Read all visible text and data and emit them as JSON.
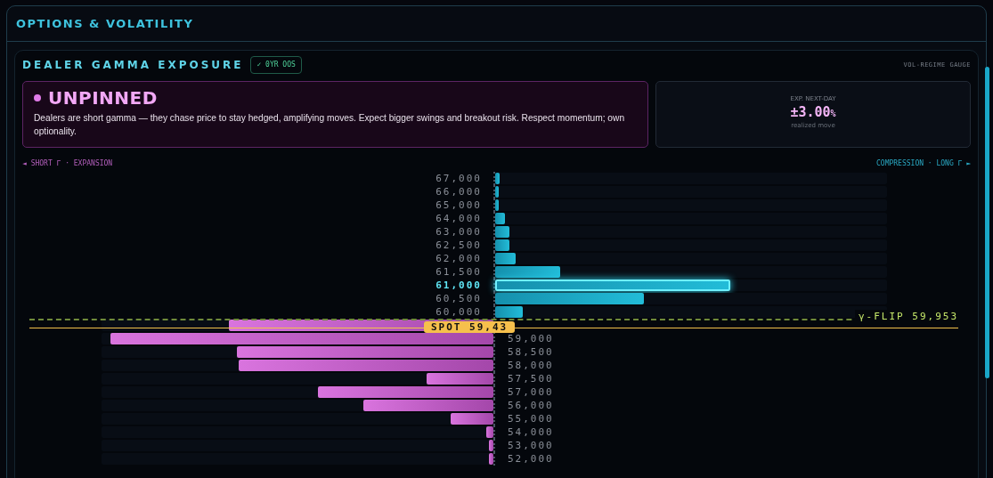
{
  "panel": {
    "title": "OPTIONS & VOLATILITY"
  },
  "card": {
    "title": "DEALER GAMMA EXPOSURE",
    "badge": "✓ 0YR OOS",
    "gauge_label": "VOL-REGIME GAUGE"
  },
  "regime": {
    "title": "UNPINNED",
    "color": "#e07be8",
    "description": "Dealers are short gamma — they chase price to stay hedged, amplifying moves. Expect bigger swings and breakout risk. Respect momentum; own optionality."
  },
  "expected_move": {
    "label": "EXP. NEXT-DAY",
    "value": "±3.00",
    "unit": "%",
    "caption": "realized move"
  },
  "directions": {
    "left": "◄ SHORT Γ · EXPANSION",
    "right": "COMPRESSION · LONG Γ ►"
  },
  "strikes": [
    {
      "strike": "67,000",
      "kind": "long",
      "level": 0.012,
      "selected": false
    },
    {
      "strike": "66,000",
      "kind": "long",
      "level": 0.01,
      "selected": false
    },
    {
      "strike": "65,000",
      "kind": "long",
      "level": 0.01,
      "selected": false
    },
    {
      "strike": "64,000",
      "kind": "long",
      "level": 0.025,
      "selected": false
    },
    {
      "strike": "63,000",
      "kind": "long",
      "level": 0.037,
      "selected": false
    },
    {
      "strike": "62,500",
      "kind": "long",
      "level": 0.037,
      "selected": false
    },
    {
      "strike": "62,000",
      "kind": "long",
      "level": 0.052,
      "selected": false
    },
    {
      "strike": "61,500",
      "kind": "long",
      "level": 0.166,
      "selected": false
    },
    {
      "strike": "61,000",
      "kind": "long",
      "level": 0.6,
      "selected": true
    },
    {
      "strike": "60,500",
      "kind": "long",
      "level": 0.38,
      "selected": false
    },
    {
      "strike": "60,000",
      "kind": "long",
      "level": 0.07,
      "selected": false
    },
    {
      "kind": "short",
      "level": 0.675,
      "selected": false
    },
    {
      "strike": "59,000",
      "kind": "short",
      "level": 0.977,
      "selected": false
    },
    {
      "strike": "58,500",
      "kind": "short",
      "level": 0.655,
      "selected": false
    },
    {
      "strike": "58,000",
      "kind": "short",
      "level": 0.65,
      "selected": false
    },
    {
      "strike": "57,500",
      "kind": "short",
      "level": 0.17,
      "selected": false
    },
    {
      "strike": "57,000",
      "kind": "short",
      "level": 0.448,
      "selected": false
    },
    {
      "strike": "56,000",
      "kind": "short",
      "level": 0.332,
      "selected": false
    },
    {
      "strike": "55,000",
      "kind": "short",
      "level": 0.109,
      "selected": false
    },
    {
      "strike": "54,000",
      "kind": "short",
      "level": 0.018,
      "selected": false
    },
    {
      "strike": "53,000",
      "kind": "short",
      "level": 0.012,
      "selected": false
    },
    {
      "strike": "52,000",
      "kind": "short",
      "level": 0.012,
      "selected": false
    }
  ],
  "gamma_flip": {
    "label": "γ-FLIP 59,953"
  },
  "spot": {
    "label": "SPOT 59,43"
  }
}
